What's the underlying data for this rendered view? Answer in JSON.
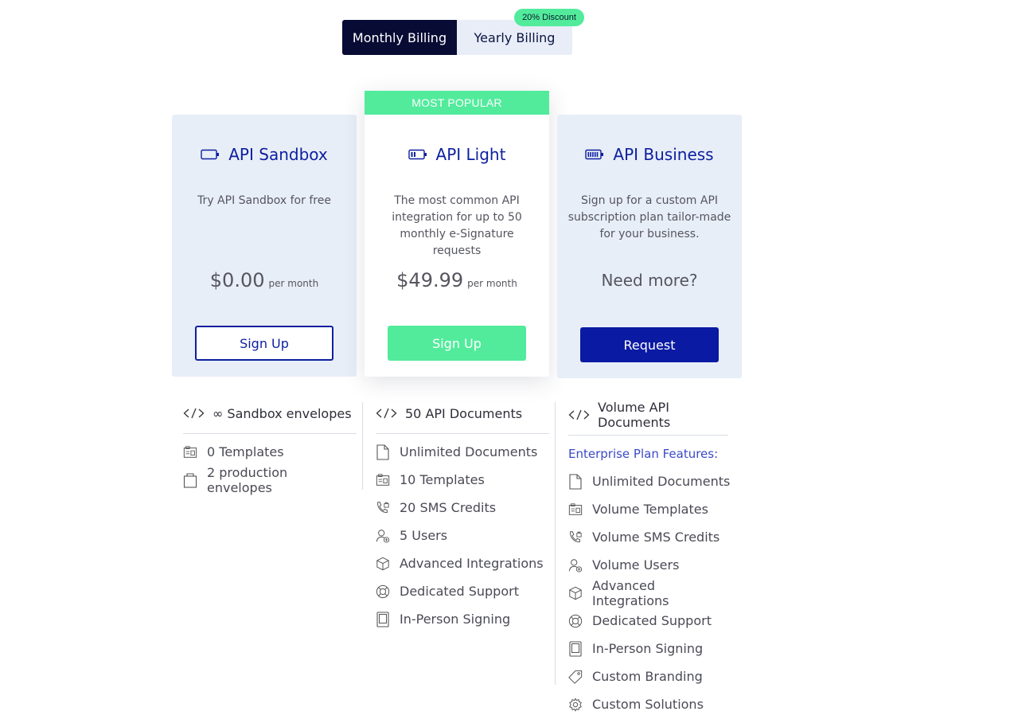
{
  "billing": {
    "monthly_label": "Monthly Billing",
    "yearly_label": "Yearly Billing",
    "discount_badge": "20% Discount",
    "selected": "Monthly Billing"
  },
  "colors": {
    "navy": "#080b34",
    "brand_blue": "#0c1fa0",
    "green": "#52eb9c",
    "card_bg": "#e8eef7"
  },
  "plans": [
    {
      "name": "API Sandbox",
      "icon": "battery-empty-icon",
      "description": "Try API Sandbox for free",
      "price": "$0.00",
      "period": "per month",
      "button": "Sign Up"
    },
    {
      "name": "API Light",
      "icon": "battery-low-icon",
      "banner": "MOST POPULAR",
      "description": "The most common API integration for up to 50 monthly e-Signature requests",
      "price": "$49.99",
      "period": "per month",
      "button": "Sign Up"
    },
    {
      "name": "API Business",
      "icon": "battery-full-icon",
      "description": "Sign up for a custom API subscription plan tailor-made for your business.",
      "price_text": "Need more?",
      "button": "Request"
    }
  ],
  "features": {
    "sandbox": {
      "headline": "∞ Sandbox envelopes",
      "items": [
        {
          "icon": "templates-icon",
          "label": "0 Templates"
        },
        {
          "icon": "envelope-bag-icon",
          "label": "2 production envelopes"
        }
      ]
    },
    "light": {
      "headline": "50 API Documents",
      "items": [
        {
          "icon": "document-icon",
          "label": "Unlimited Documents"
        },
        {
          "icon": "templates-icon",
          "label": "10 Templates"
        },
        {
          "icon": "phone-lock-icon",
          "label": "20 SMS Credits"
        },
        {
          "icon": "user-add-icon",
          "label": "5 Users"
        },
        {
          "icon": "cube-icon",
          "label": "Advanced Integrations"
        },
        {
          "icon": "lifebuoy-icon",
          "label": "Dedicated Support"
        },
        {
          "icon": "tablet-icon",
          "label": "In-Person Signing"
        }
      ]
    },
    "business": {
      "headline": "Volume API Documents",
      "enterprise_label": "Enterprise Plan Features:",
      "items": [
        {
          "icon": "document-icon",
          "label": "Unlimited Documents"
        },
        {
          "icon": "templates-icon",
          "label": "Volume Templates"
        },
        {
          "icon": "phone-lock-icon",
          "label": "Volume SMS Credits"
        },
        {
          "icon": "user-add-icon",
          "label": "Volume Users"
        },
        {
          "icon": "cube-icon",
          "label": "Advanced Integrations"
        },
        {
          "icon": "lifebuoy-icon",
          "label": "Dedicated Support"
        },
        {
          "icon": "tablet-icon",
          "label": "In-Person Signing"
        },
        {
          "icon": "tag-icon",
          "label": "Custom Branding"
        },
        {
          "icon": "gear-icon",
          "label": "Custom Solutions"
        }
      ]
    }
  }
}
